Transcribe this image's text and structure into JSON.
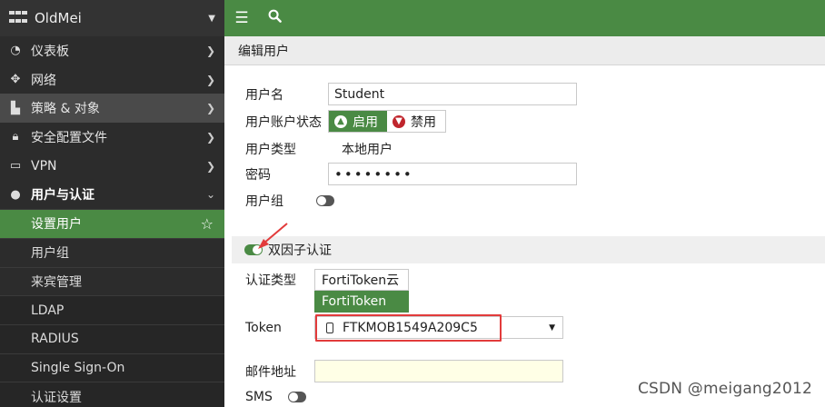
{
  "sidebar": {
    "title": "OldMei",
    "items": [
      {
        "label": "仪表板",
        "icon": "dashboard-icon"
      },
      {
        "label": "网络",
        "icon": "network-move-icon"
      },
      {
        "label": "策略 & 对象",
        "icon": "policy-icon"
      },
      {
        "label": "安全配置文件",
        "icon": "lock-icon"
      },
      {
        "label": "VPN",
        "icon": "laptop-icon"
      },
      {
        "label": "用户与认证",
        "icon": "user-icon"
      }
    ],
    "subitems": [
      {
        "label": "设置用户"
      },
      {
        "label": "用户组"
      },
      {
        "label": "来宾管理"
      },
      {
        "label": "LDAP"
      },
      {
        "label": "RADIUS"
      },
      {
        "label": "Single Sign-On"
      },
      {
        "label": "认证设置"
      }
    ]
  },
  "header": {
    "breadcrumb": "编辑用户"
  },
  "form": {
    "username_label": "用户名",
    "username_value": "Student",
    "status_label": "用户账户状态",
    "status_enable": "启用",
    "status_disable": "禁用",
    "type_label": "用户类型",
    "type_value": "本地用户",
    "password_label": "密码",
    "password_value": "••••••••",
    "group_label": "用户组",
    "twofactor_label": "双因子认证",
    "auth_type_label": "认证类型",
    "auth_options": [
      "FortiToken云",
      "FortiToken"
    ],
    "token_label": "Token",
    "token_value": "FTKMOB1549A209C5",
    "email_label": "邮件地址",
    "email_value": "",
    "sms_label": "SMS"
  },
  "watermark": "CSDN @meigang2012",
  "colors": {
    "accent": "#4a8a44",
    "highlight": "#e23b3b",
    "sidebar_bg": "#2c2c2c"
  }
}
